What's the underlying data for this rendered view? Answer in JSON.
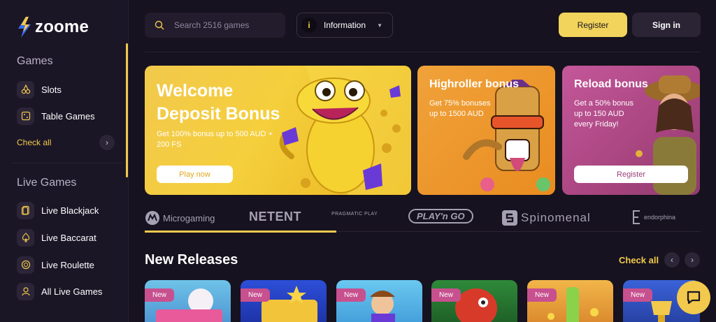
{
  "brand": {
    "name": "zoome",
    "accent": "#f2c94c"
  },
  "sidebar": {
    "games_title": "Games",
    "games_items": [
      {
        "label": "Slots",
        "icon": "cherries-icon"
      },
      {
        "label": "Table Games",
        "icon": "dice-icon"
      }
    ],
    "check_all": "Check all",
    "live_title": "Live Games",
    "live_items": [
      {
        "label": "Live Blackjack",
        "icon": "cards-icon"
      },
      {
        "label": "Live Baccarat",
        "icon": "spade-icon"
      },
      {
        "label": "Live Roulette",
        "icon": "roulette-icon"
      },
      {
        "label": "All Live Games",
        "icon": "dealer-icon"
      }
    ]
  },
  "header": {
    "search_placeholder": "Search 2516 games",
    "info_label": "Information",
    "register": "Register",
    "signin": "Sign in"
  },
  "banners": [
    {
      "title": "Welcome Deposit Bonus",
      "desc": "Get 100% bonus up to 500 AUD + 200 FS",
      "button": "Play now"
    },
    {
      "title": "Highroller bonus",
      "desc": "Get 75% bonuses up to 1500 AUD"
    },
    {
      "title": "Reload bonus",
      "desc": "Get a 50% bonus up to 150 AUD every Friday!",
      "button": "Register"
    }
  ],
  "providers": [
    "Microgaming",
    "NETENT",
    "PRAGMATIC PLAY",
    "PLAY'n GO",
    "Spinomenal",
    "endorphina"
  ],
  "new_releases": {
    "title": "New Releases",
    "check_all": "Check all",
    "tiles": [
      {
        "badge": "New"
      },
      {
        "badge": "New"
      },
      {
        "badge": "New"
      },
      {
        "badge": "New"
      },
      {
        "badge": "New"
      },
      {
        "badge": "New"
      }
    ]
  }
}
